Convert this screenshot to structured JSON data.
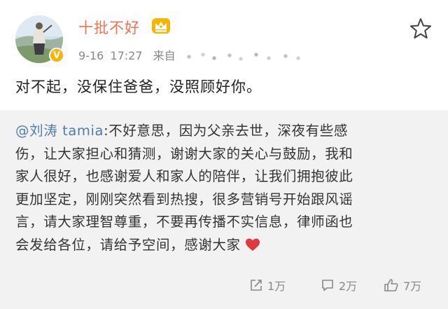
{
  "user": {
    "name": "十批不好"
  },
  "meta": {
    "date": "9-16",
    "time": "17:27",
    "source_prefix": "来自"
  },
  "post": {
    "text": "对不起，没保住爸爸，没照顾好你。"
  },
  "repost": {
    "author": "@刘涛 tamia",
    "lines": [
      ":不好意思，因为父亲去世，深夜有些感",
      "伤，让大家担心和猜测，谢谢大家的关心与鼓励，我和",
      "家人很好，也感谢爱人和家人的陪伴，让我们拥抱彼此",
      "更加坚定，刚刚突然看到热搜，很多营销号开始跟风谣",
      "言，请大家理智尊重，不要再传播不实信息，律师函也",
      "会发给各位，请给予空间，感谢大家"
    ]
  },
  "actions": {
    "repost_count": "1万",
    "comment_count": "2万",
    "like_count": "7万"
  },
  "colors": {
    "username": "#eb7350",
    "mention": "#507daf",
    "repost_bg": "#f2f2f2",
    "heart": "#e0393e",
    "badge": "#f7b500"
  },
  "icons": {
    "crown": "crown-icon",
    "more": "star-icon",
    "repost": "repost-icon",
    "comment": "comment-icon",
    "like": "thumb-up-icon",
    "heart": "heart-icon",
    "verify": "verified-badge-icon"
  }
}
